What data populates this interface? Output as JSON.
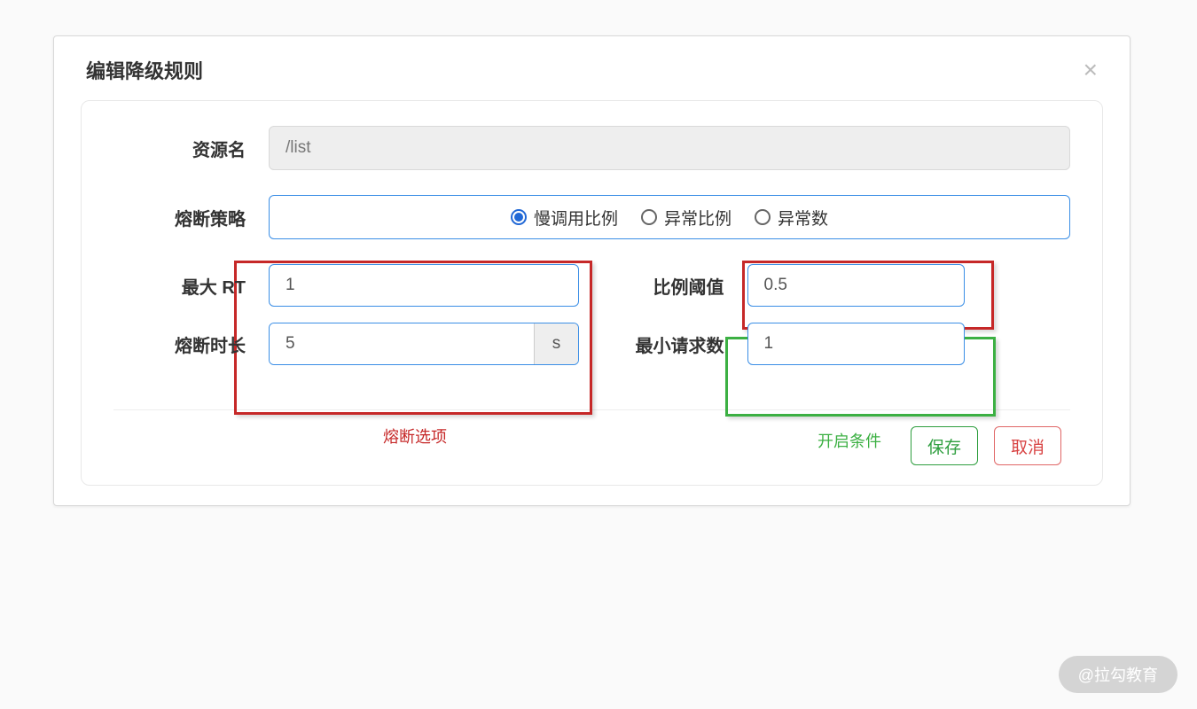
{
  "modal": {
    "title": "编辑降级规则",
    "close": "×"
  },
  "form": {
    "resource_label": "资源名",
    "resource_value": "/list",
    "strategy_label": "熔断策略",
    "strategy_options": {
      "slow": "慢调用比例",
      "exc_ratio": "异常比例",
      "exc_count": "异常数"
    },
    "max_rt_label": "最大 RT",
    "max_rt_value": "1",
    "ratio_label": "比例阈值",
    "ratio_value": "0.5",
    "break_time_label": "熔断时长",
    "break_time_value": "5",
    "break_time_unit": "s",
    "min_req_label": "最小请求数",
    "min_req_value": "1"
  },
  "annotations": {
    "red_label": "熔断选项",
    "green_label": "开启条件"
  },
  "actions": {
    "save": "保存",
    "cancel": "取消"
  },
  "watermark": "@拉勾教育"
}
